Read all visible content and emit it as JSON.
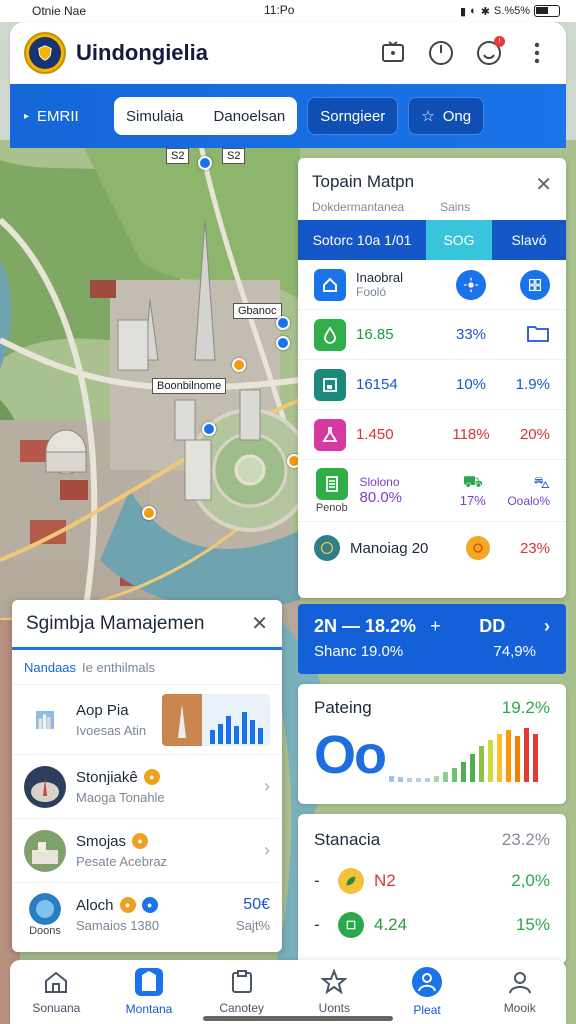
{
  "status_bar": {
    "carrier": "Otnie Nae",
    "clock": "11:Po",
    "battery_text": "S.%5%"
  },
  "header": {
    "title": "Uindongielia"
  },
  "toolbar": {
    "left_label": "EMRII",
    "segment_left": "Simulaia",
    "segment_right": "Danoelsan",
    "button_1": "Sorngieer",
    "button_2": "Ong"
  },
  "map": {
    "labels": [
      "Gbanoc",
      "Boonbilnome"
    ],
    "top_badges": [
      "S2",
      "S2"
    ]
  },
  "right_panel": {
    "title": "Topain Matpn",
    "subtitle_left": "Dokdermantanea",
    "subtitle_right": "Sains",
    "tabs": [
      "Sotorc 10a 1/01",
      "SOG",
      "Slavó"
    ],
    "rows": [
      {
        "c1": "Inaobral",
        "c1_sub": "Fooló",
        "color": "#1a73e8"
      },
      {
        "c1": "16.85",
        "c2": "33%",
        "color": "#2fae4a",
        "c1_color": "#1a9a40",
        "c2_color": "#1a57c9"
      },
      {
        "c1": "16154",
        "c2": "10%",
        "c3": "1.9%",
        "color": "#1b8a7a",
        "c1_color": "#1a57c9",
        "c2_color": "#1a57c9",
        "c3_color": "#1a57c9"
      },
      {
        "c1": "1.450",
        "c2": "118%",
        "c3": "20%",
        "color": "#d63aa0",
        "c1_color": "#d7333a",
        "c2_color": "#d7333a",
        "c3_color": "#d7333a"
      },
      {
        "c1": "80.0%",
        "c1_top": "Slolono",
        "c1_sub": "Penob",
        "c2": "17%",
        "c3": "Ooalo%",
        "color": "#2fae4a",
        "c1_color": "#7b3fc9",
        "c2_color": "#7b3fc9",
        "c3_color": "#7b3fc9"
      }
    ],
    "footer": {
      "label": "Manoiag 20",
      "value": "23%"
    }
  },
  "blue_card": {
    "top_left": "2N — 18.2%",
    "top_right": "DD",
    "bottom_left": "Shanc 19.0%",
    "bottom_right": "74,9%"
  },
  "chart_card": {
    "title": "Pateing",
    "percent": "19.2%",
    "big": "Oo"
  },
  "stat_card": {
    "title": "Stanacia",
    "value": "23.2%",
    "rows": [
      {
        "value": "N2",
        "percent": "2,0%",
        "value_color": "#d7333a"
      },
      {
        "value": "4.24",
        "percent": "15%",
        "value_color": "#2a9a3a"
      }
    ]
  },
  "left_sheet": {
    "title": "Sgimbja Mamajemen",
    "subtitle_strong": "Nandaas",
    "subtitle_rest": "Ie enthilmals",
    "items": [
      {
        "name": "Aop Pia",
        "meta": "Ivoesas Atin"
      },
      {
        "name": "Stonjiakê",
        "meta": "Maoga Tonahle"
      },
      {
        "name": "Smojas",
        "meta": "Pesate Acebraz"
      },
      {
        "name": "Aloch",
        "meta": "Samaios 1380",
        "side_big": "50€",
        "side_small": "Sajt%",
        "thumb_caption": "Doons"
      }
    ]
  },
  "bottom_nav": {
    "items": [
      {
        "label": "Sonuana",
        "icon": "home-icon"
      },
      {
        "label": "Montana",
        "icon": "building-icon"
      },
      {
        "label": "Canotey",
        "icon": "clipboard-icon"
      },
      {
        "label": "Uonts",
        "icon": "star-icon"
      },
      {
        "label": "Pleat",
        "icon": "person-icon"
      },
      {
        "label": "Mooik",
        "icon": "profile-icon"
      }
    ]
  },
  "colors": {
    "brand_blue": "#1a73e8",
    "dark_blue": "#1460d9",
    "cyan_tab": "#38c5dc",
    "green": "#2aa84a",
    "red": "#d7333a"
  }
}
